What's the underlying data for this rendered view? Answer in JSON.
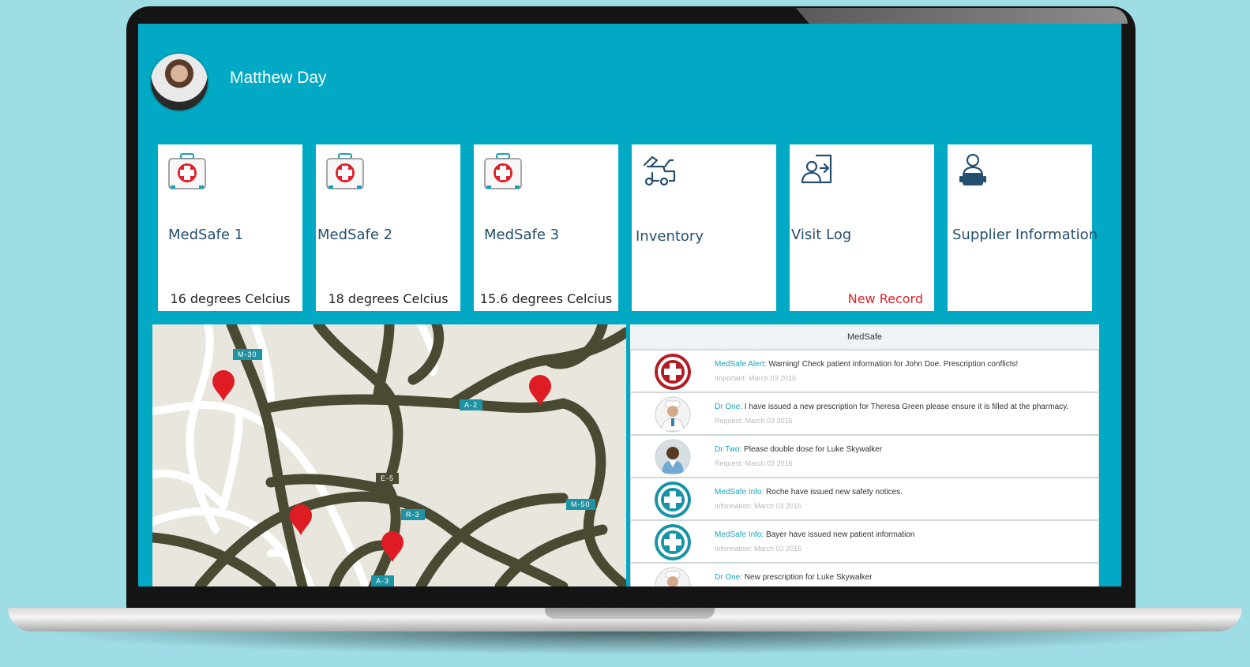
{
  "user": {
    "name": "Matthew Day"
  },
  "tiles": [
    {
      "title": "MedSafe 1",
      "footer": "16 degrees Celcius",
      "icon": "first-aid-kit-icon"
    },
    {
      "title": "MedSafe 2",
      "footer": "18 degrees Celcius",
      "icon": "first-aid-kit-icon"
    },
    {
      "title": "MedSafe 3",
      "footer": "15.6 degrees Celcius",
      "icon": "first-aid-kit-icon"
    },
    {
      "title": "Inventory",
      "footer": "",
      "icon": "delivery-truck-icon"
    },
    {
      "title": "Visit Log",
      "footer": "New Record",
      "icon": "user-login-icon"
    },
    {
      "title": "Supplier Information",
      "footer": "",
      "icon": "supplier-person-icon"
    }
  ],
  "map": {
    "road_labels": [
      "M-30",
      "A-2",
      "E-5",
      "M-50",
      "R-3",
      "A-3"
    ]
  },
  "feed": {
    "header": "MedSafe",
    "items": [
      {
        "sender": "MedSafe Alert:",
        "message": " Warning! Check patient information for John Doe. Prescription conflicts!",
        "meta": "Important: March 03 2016",
        "avatar": "red-cross-icon"
      },
      {
        "sender": "Dr One:",
        "message": " I have issued a new prescription for Theresa  Green please ensure it is filled at the pharmacy.",
        "meta": "Request: March 03 2016",
        "avatar": "doctor-avatar"
      },
      {
        "sender": "Dr Two:",
        "message": " Please double dose for Luke Skywalker",
        "meta": "Request: March 03 2016",
        "avatar": "doctor-avatar"
      },
      {
        "sender": "MedSafe Info:",
        "message": " Roche have issued new safety notices.",
        "meta": "Information: March 03 2016",
        "avatar": "teal-cross-icon"
      },
      {
        "sender": "MedSafe Info:",
        "message": "  Bayer have issued new patient information",
        "meta": "Information: March 03 2016",
        "avatar": "teal-cross-icon"
      },
      {
        "sender": "Dr One:",
        "message": " New prescription for Luke Skywalker",
        "meta": "",
        "avatar": "doctor-avatar"
      }
    ]
  },
  "colors": {
    "screen_bg": "#01a9c4",
    "accent_text": "#254f6e",
    "alert_red": "#e0212b",
    "teal": "#1aa3b8"
  }
}
